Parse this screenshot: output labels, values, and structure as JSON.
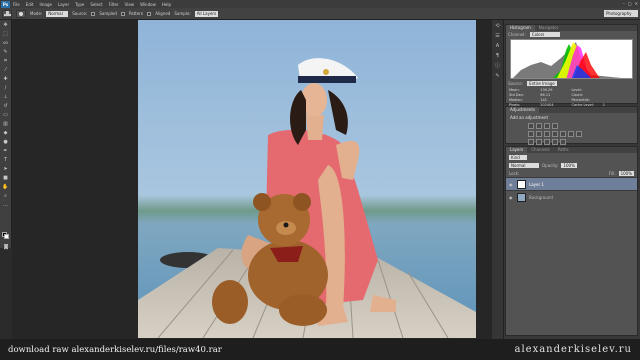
{
  "menubar": {
    "logo": "Ps",
    "items": [
      "File",
      "Edit",
      "Image",
      "Layer",
      "Type",
      "Select",
      "Filter",
      "View",
      "Window",
      "Help"
    ],
    "window_controls": [
      "–",
      "□",
      "✕"
    ]
  },
  "options": {
    "mode_label": "Mode:",
    "mode_value": "Normal",
    "source_label": "Source:",
    "source_value": "Sampled",
    "pattern_label": "Pattern",
    "aligned_label": "Aligned",
    "sample_label": "Sample:",
    "sample_value": "All Layers",
    "workspace": "Photography"
  },
  "histogram": {
    "tabs": [
      "Histogram",
      "Navigator"
    ],
    "channel_label": "Channel:",
    "channel_value": "Colors",
    "source_label": "Source:",
    "source_value": "Entire Image",
    "stats": [
      [
        "Mean:",
        "139.29",
        "Level:",
        ""
      ],
      [
        "Std Dev:",
        "66.11",
        "Count:",
        ""
      ],
      [
        "Median:",
        "141",
        "Percentile:",
        ""
      ],
      [
        "Pixels:",
        "202404",
        "Cache Level:",
        "1"
      ]
    ]
  },
  "adjustments": {
    "tabs": [
      "Adjustments"
    ],
    "title": "Add an adjustment"
  },
  "layers": {
    "tabs": [
      "Layers",
      "Channels",
      "Paths"
    ],
    "kind_value": "Kind",
    "blend_value": "Normal",
    "opacity_label": "Opacity:",
    "opacity_value": "100%",
    "lock_label": "Lock:",
    "fill_label": "Fill:",
    "fill_value": "100%",
    "rows": [
      {
        "name": "Layer 1",
        "selected": true
      },
      {
        "name": "Background",
        "selected": false
      }
    ]
  },
  "footer": {
    "left_text": "download raw alexanderkiselev.ru/files/raw40.rar",
    "right_text": "alexanderkiselev.ru"
  },
  "colors": {
    "selected_layer": "#6f7f99",
    "ps_blue": "#2a6fa8"
  }
}
